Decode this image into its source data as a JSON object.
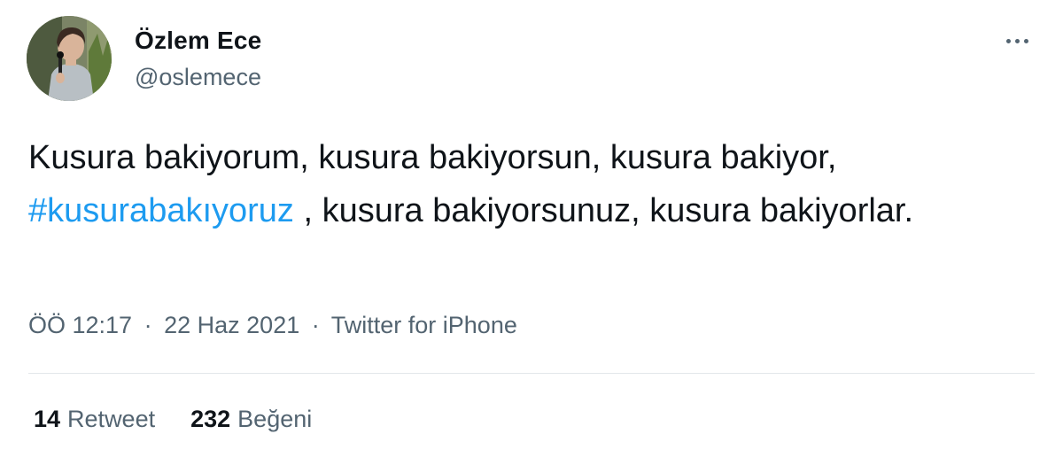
{
  "author": {
    "name": "Özlem Ece",
    "handle": "@oslemece",
    "avatar_icon": "profile-photo"
  },
  "menu": {
    "icon": "more-horizontal-icon"
  },
  "tweet": {
    "text_part1": "Kusura bakiyorum, kusura bakiyorsun, kusura bakiyor,",
    "hashtag": "#kusurabakıyoruz",
    "text_part2": " , kusura bakiyorsunuz, kusura bakiyorlar."
  },
  "meta": {
    "time": "ÖÖ 12:17",
    "separator": "·",
    "date": "22 Haz 2021",
    "source": "Twitter for iPhone"
  },
  "stats": {
    "retweets_count": "14",
    "retweets_label": "Retweet",
    "likes_count": "232",
    "likes_label": "Beğeni"
  },
  "colors": {
    "link": "#1d9bf0",
    "secondary_text": "#536471",
    "primary_text": "#0f1419",
    "divider": "#e3e7ea"
  }
}
